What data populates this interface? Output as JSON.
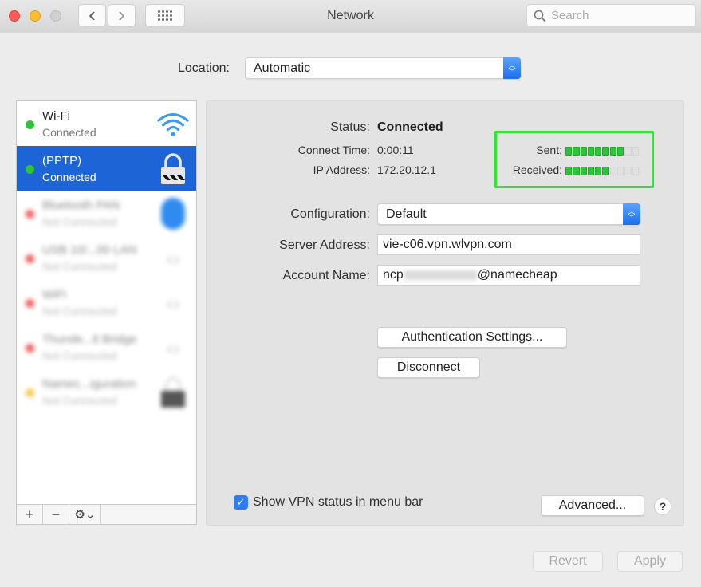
{
  "window": {
    "title": "Network",
    "search_placeholder": "Search",
    "nav": {
      "back": "‹",
      "forward": "›"
    }
  },
  "location": {
    "label": "Location:",
    "value": "Automatic"
  },
  "sidebar": {
    "services": [
      {
        "name": "Wi-Fi",
        "status": "Connected",
        "dot_color": "#2fc23b",
        "icon": "wifi-icon",
        "selected": false,
        "blurred": false
      },
      {
        "name": "(PPTP)",
        "status": "Connected",
        "dot_color": "#2fc23b",
        "icon": "lock-icon",
        "selected": true,
        "blurred": false
      },
      {
        "name": "Bluetooth PAN",
        "status": "Not Connected",
        "dot_color": "#f25c5c",
        "icon": "bluetooth-icon",
        "selected": false,
        "blurred": true
      },
      {
        "name": "USB 10/...00 LAN",
        "status": "Not Connected",
        "dot_color": "#f25c5c",
        "icon": "ethernet-icon",
        "selected": false,
        "blurred": true
      },
      {
        "name": "WiFi",
        "status": "Not Connected",
        "dot_color": "#f25c5c",
        "icon": "ethernet-icon",
        "selected": false,
        "blurred": true
      },
      {
        "name": "Thunde...lt Bridge",
        "status": "Not Connected",
        "dot_color": "#f25c5c",
        "icon": "ethernet-icon",
        "selected": false,
        "blurred": true
      },
      {
        "name": "Namec...iguration",
        "status": "Not Connected",
        "dot_color": "#f8c84a",
        "icon": "lock-icon",
        "selected": false,
        "blurred": true
      }
    ],
    "toolbar": {
      "add": "+",
      "remove": "−",
      "gear": "⚙⌄"
    }
  },
  "detail": {
    "status_label": "Status:",
    "status_value": "Connected",
    "connect_time_label": "Connect Time:",
    "connect_time_value": "0:00:11",
    "ip_label": "IP Address:",
    "ip_value": "172.20.12.1",
    "sent_label": "Sent:",
    "sent_level": 0.8,
    "received_label": "Received:",
    "received_level": 0.6,
    "meter_segments": 10,
    "highlight_color": "#2de82d",
    "configuration_label": "Configuration:",
    "configuration_value": "Default",
    "server_label": "Server Address:",
    "server_value": "vie-c06.vpn.wlvpn.com",
    "account_label": "Account Name:",
    "account_prefix": "ncp",
    "account_suffix": "@namecheap",
    "auth_button": "Authentication Settings...",
    "disconnect_button": "Disconnect",
    "show_vpn_label": "Show VPN status in menu bar",
    "show_vpn_checked": true,
    "advanced_button": "Advanced...",
    "help_button": "?"
  },
  "footer": {
    "revert": "Revert",
    "apply": "Apply"
  },
  "colors": {
    "selection": "#1d65d6",
    "accent": "#2e7cf6"
  }
}
